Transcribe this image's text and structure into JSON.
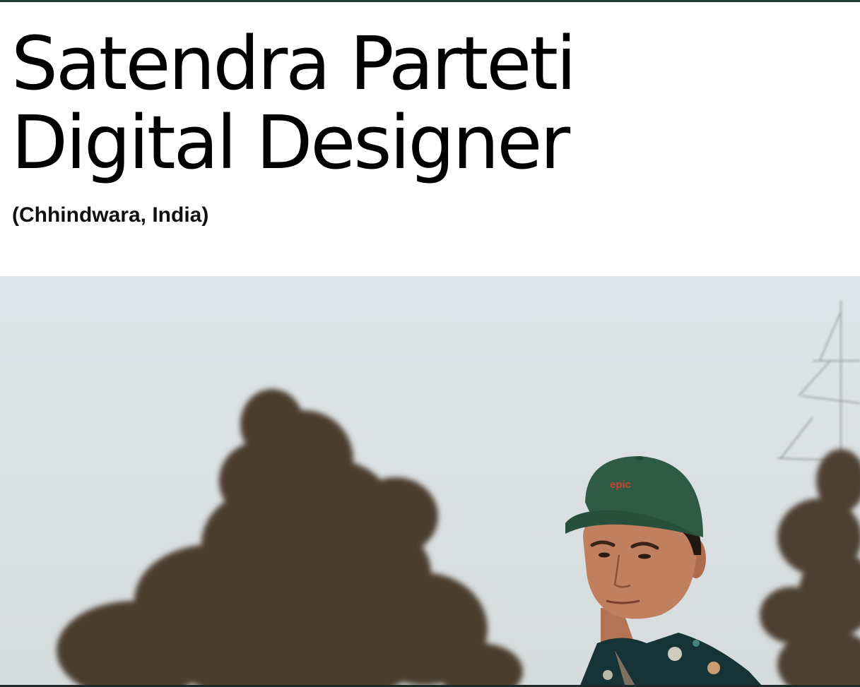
{
  "hero": {
    "name": "Satendra Parteti",
    "role": "Digital Designer",
    "location": "(Chhindwara, India)"
  },
  "photo": {
    "cap_logo": "epic"
  },
  "colors": {
    "top_bar": "#233a33",
    "cap": "#2e5a45",
    "cap_logo": "#c8452b",
    "sky": "#dde3e6",
    "trees": "#4e4031"
  },
  "icons": []
}
